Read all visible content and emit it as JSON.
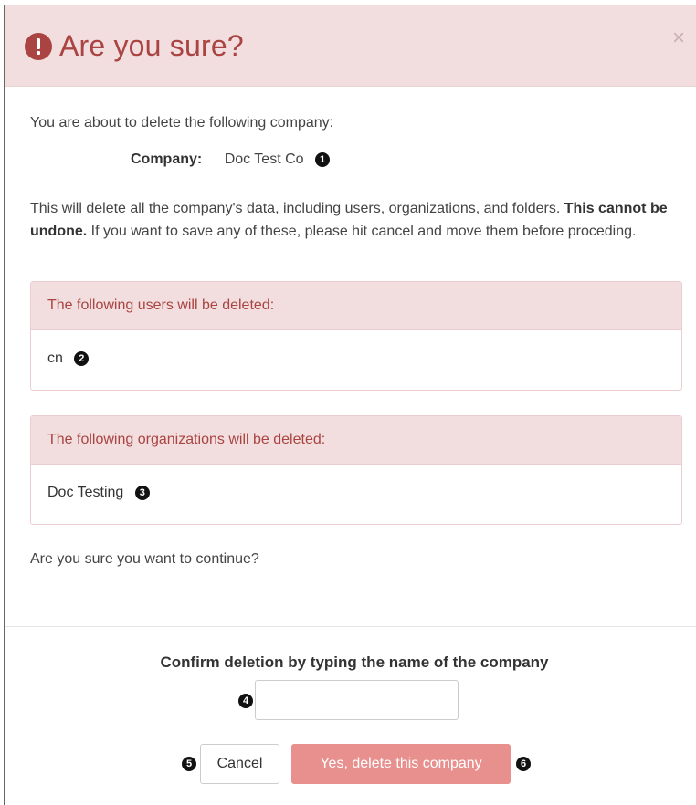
{
  "dialog": {
    "title": "Are you sure?",
    "close_symbol": "×",
    "header_icon": "exclamation-circle-icon",
    "accent_color": "#a94442",
    "header_bg": "#f2dede"
  },
  "body": {
    "intro": "You are about to delete the following company:",
    "company_label": "Company:",
    "company_name": "Doc Test Co",
    "company_callout": "1",
    "desc_text": "This will delete all the company's data, including users, organizations, and folders.",
    "desc_bold": "This cannot be undone.",
    "desc_tail": "If you want to save any of these, please hit cancel and move them before proceding.",
    "users_panel": {
      "heading": "The following users will be deleted:",
      "item": "cn",
      "callout": "2"
    },
    "orgs_panel": {
      "heading": "The following organizations will be deleted:",
      "item": "Doc Testing",
      "callout": "3"
    },
    "question": "Are you sure you want to continue?"
  },
  "footer": {
    "confirm_title": "Confirm deletion by typing the name of the company",
    "input_value": "",
    "input_callout": "4",
    "cancel_label": "Cancel",
    "cancel_callout": "5",
    "delete_label": "Yes, delete this company",
    "delete_callout": "6",
    "delete_color": "#e8908e"
  }
}
